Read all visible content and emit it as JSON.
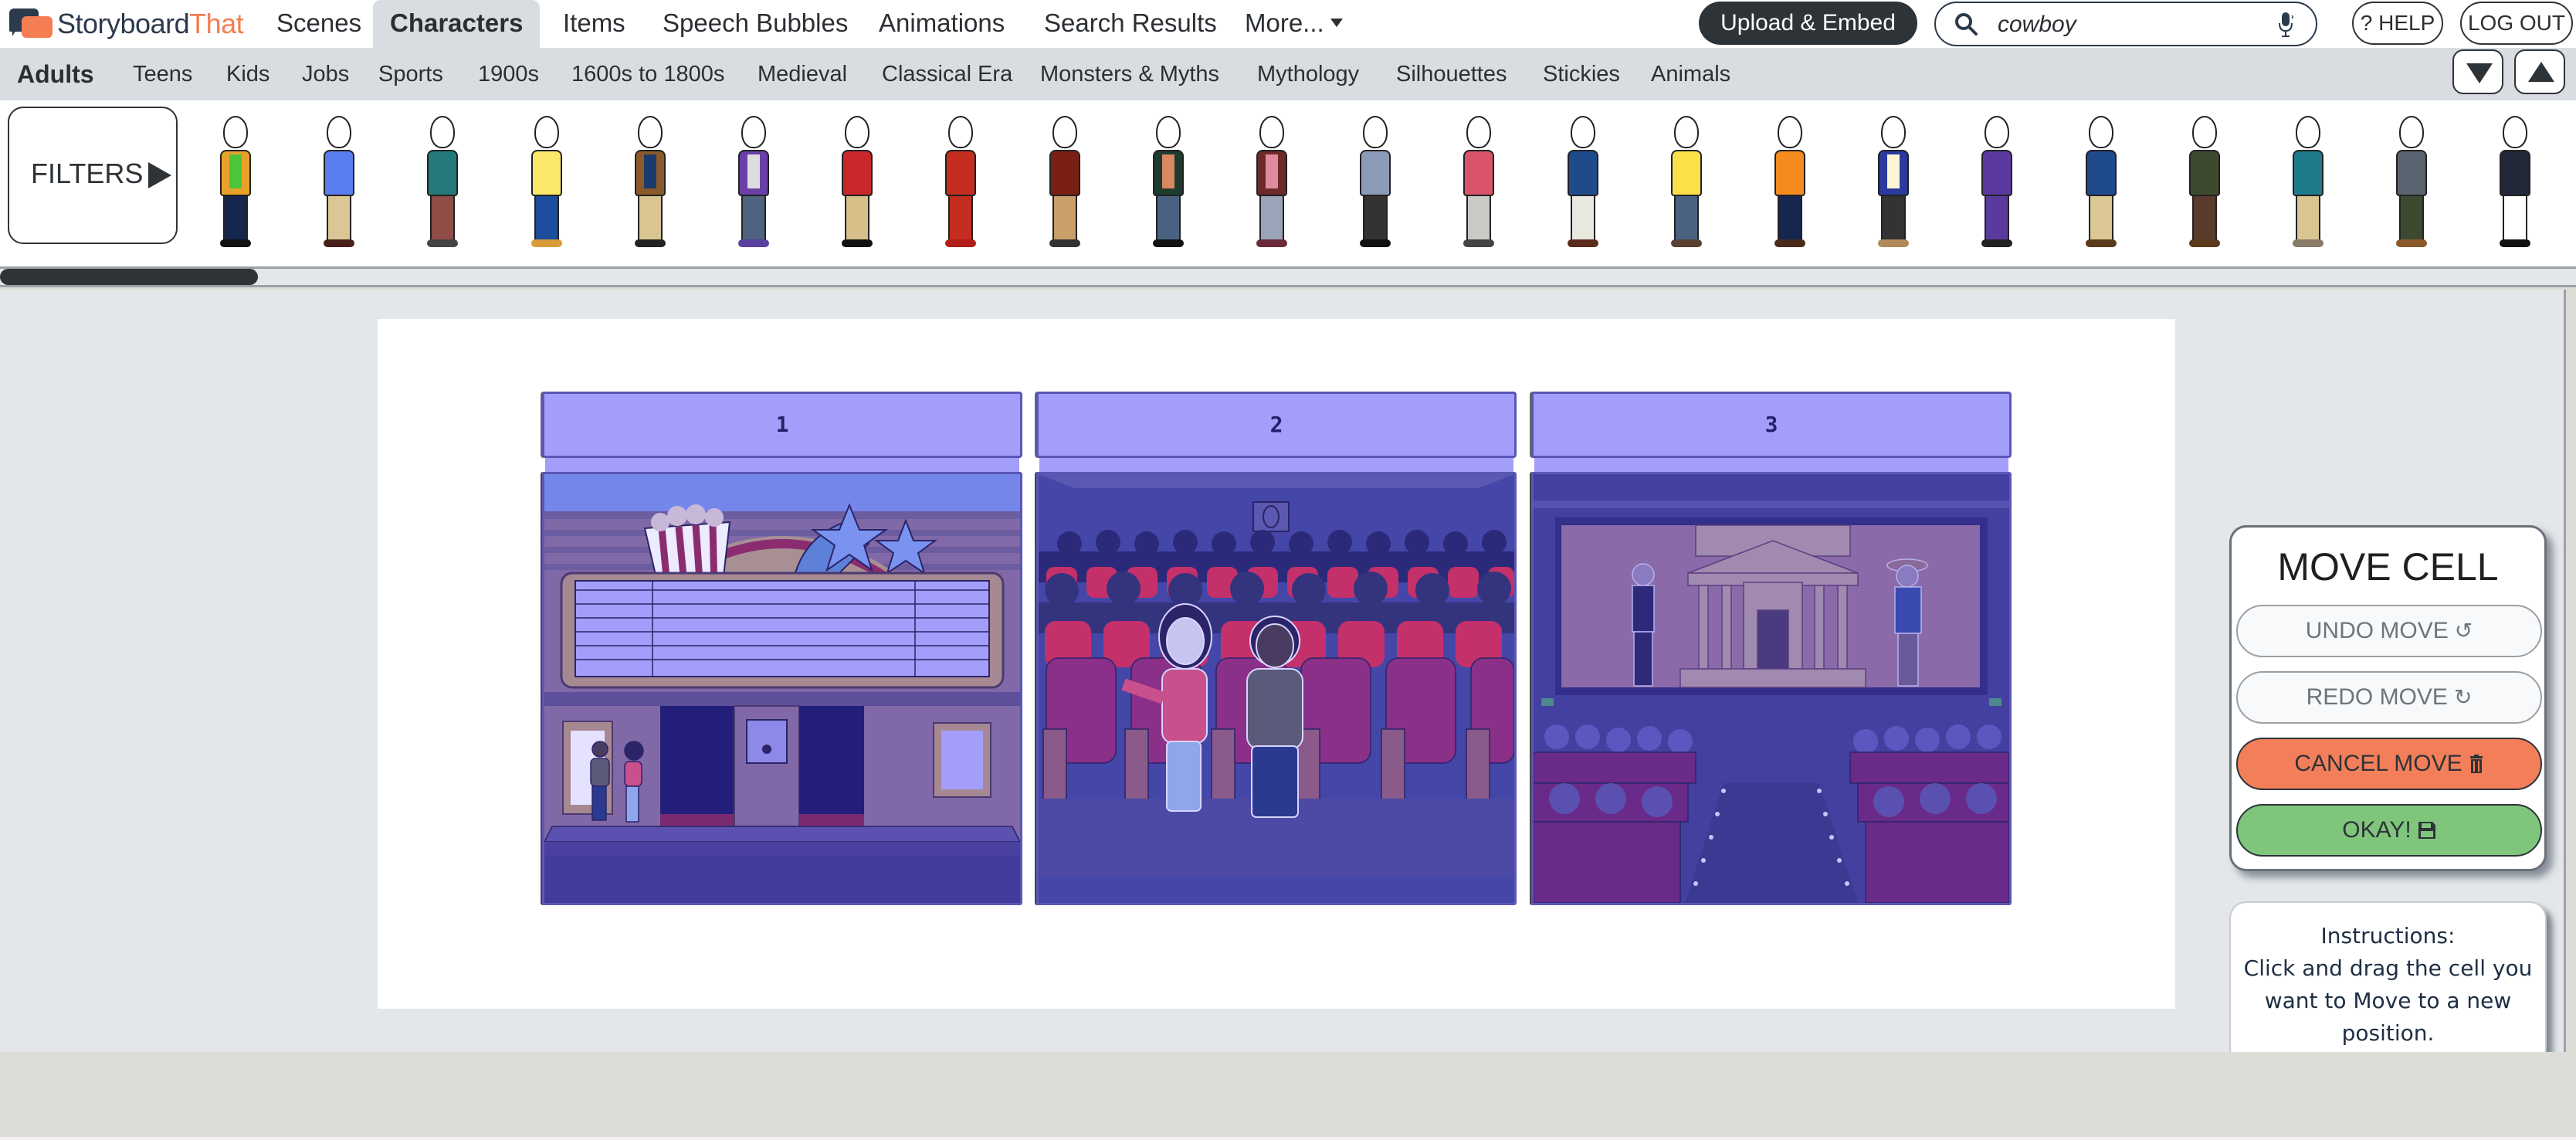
{
  "app": {
    "brand_part1": "Storyboard",
    "brand_part2": "That"
  },
  "topnav": {
    "tabs": [
      {
        "label": "Scenes",
        "active": false
      },
      {
        "label": "Characters",
        "active": true
      },
      {
        "label": "Items",
        "active": false
      },
      {
        "label": "Speech Bubbles",
        "active": false
      },
      {
        "label": "Animations",
        "active": false
      },
      {
        "label": "Search Results",
        "active": false
      },
      {
        "label": "More...",
        "active": false,
        "has_dropdown": true
      }
    ],
    "upload_label": "Upload & Embed",
    "search": {
      "value": "cowboy",
      "icon": "search-icon",
      "mic_icon": "microphone-icon"
    },
    "help_label": "? HELP",
    "logout_label": "LOG OUT"
  },
  "subnav": {
    "tabs": [
      {
        "label": "Adults",
        "active": true
      },
      {
        "label": "Teens"
      },
      {
        "label": "Kids"
      },
      {
        "label": "Jobs"
      },
      {
        "label": "Sports"
      },
      {
        "label": "1900s"
      },
      {
        "label": "1600s to 1800s"
      },
      {
        "label": "Medieval"
      },
      {
        "label": "Classical Era"
      },
      {
        "label": "Monsters & Myths"
      },
      {
        "label": "Mythology"
      },
      {
        "label": "Silhouettes"
      },
      {
        "label": "Stickies"
      },
      {
        "label": "Animals"
      }
    ],
    "collapse_icon": "triangle-down-icon",
    "expand_icon": "triangle-up-icon"
  },
  "character_strip": {
    "filters_label": "FILTERS",
    "characters": [
      {
        "top": "#e8a22a",
        "inner": "#4ec43a",
        "legs": "#15264f",
        "shoes": "#111111"
      },
      {
        "top": "#5a7ef0",
        "inner": "#5a7ef0",
        "legs": "#dac795",
        "shoes": "#4a1f1a"
      },
      {
        "top": "#247a7a",
        "inner": "#247a7a",
        "legs": "#8e4d46",
        "shoes": "#444444"
      },
      {
        "top": "#fce86a",
        "inner": "#fce86a",
        "legs": "#1d4e9e",
        "shoes": "#d99b3a"
      },
      {
        "top": "#8b5a2b",
        "inner": "#1d3a6e",
        "legs": "#d9c591",
        "shoes": "#222222"
      },
      {
        "top": "#6a3fa8",
        "inner": "#dddddd",
        "legs": "#4d6380",
        "shoes": "#5a3fa0"
      },
      {
        "top": "#c8282a",
        "inner": "#c8282a",
        "legs": "#d7bf8a",
        "shoes": "#111111"
      },
      {
        "top": "#c42d1f",
        "inner": "#c42d1f",
        "legs": "#c42d1f",
        "shoes": "#b01f1a"
      },
      {
        "top": "#7a1f14",
        "inner": "#7a1f14",
        "legs": "#c9a06a",
        "shoes": "#333333"
      },
      {
        "top": "#1e3b30",
        "inner": "#d98860",
        "legs": "#4a6282",
        "shoes": "#111111"
      },
      {
        "top": "#6e2a2a",
        "inner": "#e08aa0",
        "legs": "#9aa4b8",
        "shoes": "#6a2a3a"
      },
      {
        "top": "#8c9cb8",
        "inner": "#8c9cb8",
        "legs": "#333333",
        "shoes": "#111111"
      },
      {
        "top": "#d9536a",
        "inner": "#d9536a",
        "legs": "#c8cbc4",
        "shoes": "#444444"
      },
      {
        "top": "#1f4a8c",
        "inner": "#1f4a8c",
        "legs": "#e8e8e0",
        "shoes": "#5a2a1a"
      },
      {
        "top": "#fce04a",
        "inner": "#fce04a",
        "legs": "#4a6282",
        "shoes": "#5a4030"
      },
      {
        "top": "#f58a1f",
        "inner": "#f58a1f",
        "legs": "#15264f",
        "shoes": "#4a2a1a"
      },
      {
        "top": "#2a3a9e",
        "inner": "#fcf6d6",
        "legs": "#333333",
        "shoes": "#b08a5a"
      },
      {
        "top": "#5a3a9e",
        "inner": "#5a3a9e",
        "legs": "#5a3a9e",
        "shoes": "#222222"
      },
      {
        "top": "#1f4a8c",
        "inner": "#1f4a8c",
        "legs": "#dac795",
        "shoes": "#5a3a1a"
      },
      {
        "top": "#3e4a30",
        "inner": "#3e4a30",
        "legs": "#5a3a2a",
        "shoes": "#5a3a1a"
      },
      {
        "top": "#1f7a8c",
        "inner": "#1f7a8c",
        "legs": "#d9c591",
        "shoes": "#8a7a6a"
      },
      {
        "top": "#5a6470",
        "inner": "#5a6470",
        "legs": "#3e4a30",
        "shoes": "#8a5a2a"
      },
      {
        "top": "#222838",
        "inner": "#222838",
        "legs": "#ffffff",
        "shoes": "#111111"
      }
    ],
    "scroll_fraction": 0.1
  },
  "storyboard": {
    "cells": [
      {
        "number": "1",
        "scene": "movie-theater-exterior"
      },
      {
        "number": "2",
        "scene": "theater-seats-with-audience"
      },
      {
        "number": "3",
        "scene": "theater-screen-and-aisle"
      }
    ]
  },
  "move_panel": {
    "title": "MOVE CELL",
    "undo_label": "UNDO MOVE",
    "redo_label": "REDO MOVE",
    "cancel_label": "CANCEL MOVE",
    "okay_label": "OKAY!",
    "colors": {
      "cancel": "#f27f59",
      "okay": "#7fc67c"
    }
  },
  "instructions": {
    "heading": "Instructions:",
    "text": "Click and drag the cell you want to Move to a new position."
  }
}
